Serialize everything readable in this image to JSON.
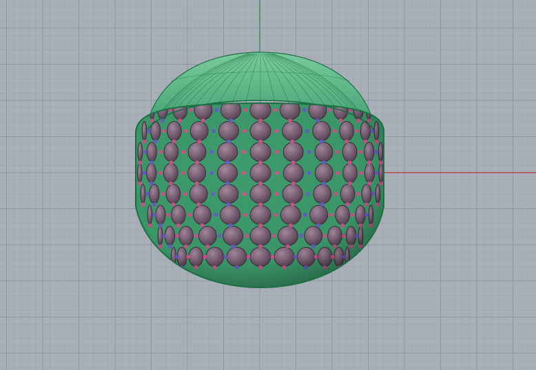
{
  "viewport": {
    "view": "Perspective",
    "colors": {
      "background": "#a9afb8",
      "minor_grid": "#9fa6ae",
      "major_grid": "#8e959e",
      "x_axis": "#b8454f",
      "y_axis": "#2a9a4e",
      "surface": "#3d9c6c",
      "surface_edge": "#1c6f43",
      "dome_top": "#79cb9c",
      "panel": "#7a6176",
      "panel_light": "#a88aa0",
      "panel_dark": "#553d50",
      "panel_edge": "#3f2c3c",
      "node": "#d8508c",
      "node_accent": "#6a5ad0"
    }
  },
  "model": {
    "object": "sphere",
    "panel_shape": "circle",
    "panel_count_visible": 130
  }
}
